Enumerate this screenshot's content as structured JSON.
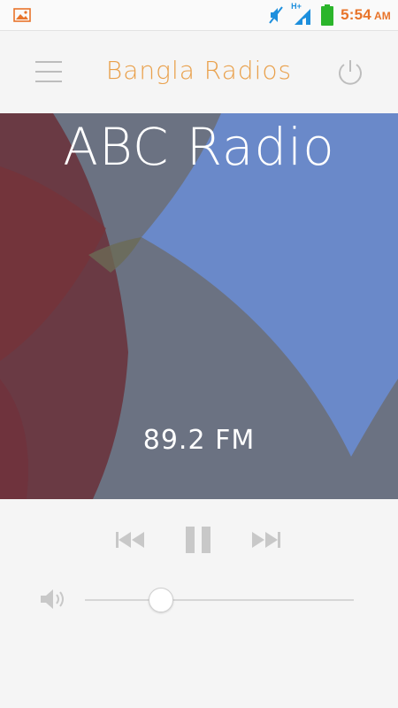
{
  "status_bar": {
    "time": "5:54",
    "ampm": "AM",
    "network_label": "H+",
    "notification_icon": "gallery-icon",
    "colors": {
      "time": "#e8742a",
      "signal": "#1d8fdd",
      "battery": "#2bb52b"
    }
  },
  "header": {
    "title": "Bangla Radios",
    "menu_icon": "hamburger-menu-icon",
    "power_icon": "power-icon",
    "title_color": "#e9a04b"
  },
  "player": {
    "station_name": "ABC Radio",
    "frequency": "89.2 FM",
    "state": "playing",
    "volume_fraction": 0.28
  },
  "controls": {
    "prev_icon": "skip-previous-icon",
    "pause_icon": "pause-icon",
    "next_icon": "skip-next-icon",
    "volume_icon": "speaker-volume-icon"
  }
}
